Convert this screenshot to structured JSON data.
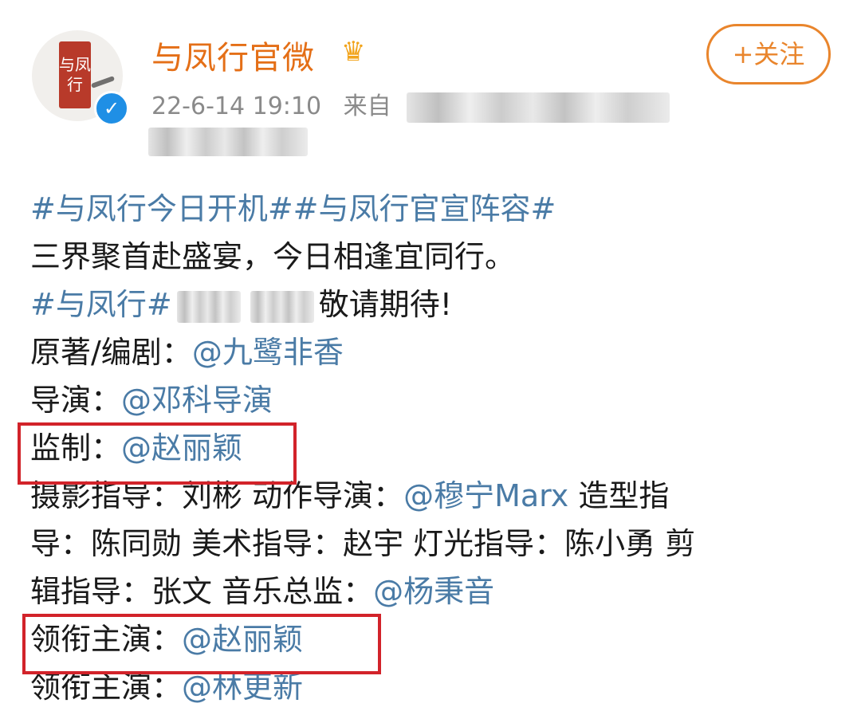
{
  "header": {
    "avatar_text": "与凤行",
    "verified_mark": "✓",
    "name": "与凤行官微",
    "crown_icon": "crown-icon",
    "time": "22-6-14 19:10",
    "source_label": "来自",
    "follow_label": "+关注"
  },
  "post": {
    "line1_tags": "#与凤行今日开机##与凤行官宣阵容#",
    "line2": "三界聚首赴盛宴，今日相逢宜同行。",
    "line3_tag": "#与凤行#",
    "line3_tail": "敬请期待!",
    "line4_label": "原著/编剧：",
    "line4_link": "@九鹭非香",
    "line5_label": "导演：",
    "line5_link": "@邓科导演",
    "line6_label": "监制：",
    "line6_link": "@赵丽颖",
    "line7_a": "摄影指导：刘彬 动作导演：",
    "line7_link": "@穆宁Marx",
    "line7_b": " 造型指",
    "line8": "导：陈同勋 美术指导：赵宇 灯光指导：陈小勇 剪",
    "line9_a": "辑指导：张文 音乐总监：",
    "line9_link": "@杨秉音",
    "line10_label": "领衔主演：",
    "line10_link": "@赵丽颖",
    "line11_label": "领衔主演：",
    "line11_link": "@林更新"
  },
  "colors": {
    "name": "#e46f17",
    "link": "#4a7ba6",
    "highlight": "#d2232a",
    "follow": "#e9852c"
  }
}
